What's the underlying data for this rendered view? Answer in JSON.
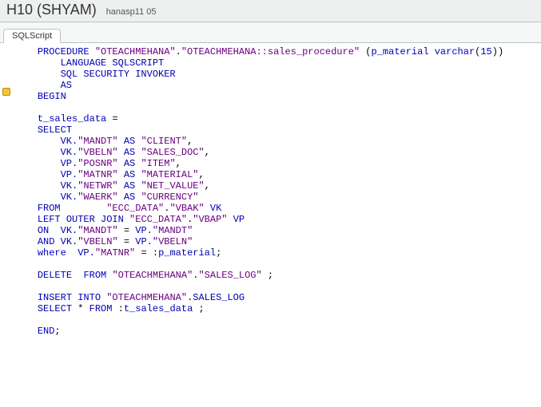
{
  "header": {
    "title": "H10 (SHYAM)",
    "subtitle": "hanasp11 05"
  },
  "tabs": [
    {
      "label": "SQLScript"
    }
  ],
  "code": {
    "tokens": [
      [
        "    ",
        ""
      ],
      [
        "PROCEDURE",
        "kw"
      ],
      [
        " ",
        ""
      ],
      [
        "\"OTEACHMEHANA\"",
        "id"
      ],
      [
        ".",
        ""
      ],
      [
        "\"OTEACHMEHANA::sales_procedure\"",
        "id"
      ],
      [
        " (",
        ""
      ],
      [
        "p_material",
        "kw"
      ],
      [
        " ",
        ""
      ],
      [
        "varchar",
        "kw"
      ],
      [
        "(",
        ""
      ],
      [
        "15",
        "lit"
      ],
      [
        "))",
        ""
      ],
      [
        "\n",
        ""
      ],
      [
        "        ",
        ""
      ],
      [
        "LANGUAGE SQLSCRIPT",
        "kw"
      ],
      [
        "\n",
        ""
      ],
      [
        "        ",
        ""
      ],
      [
        "SQL SECURITY INVOKER",
        "kw"
      ],
      [
        "\n",
        ""
      ],
      [
        "        ",
        ""
      ],
      [
        "AS",
        "kw"
      ],
      [
        "\n",
        ""
      ],
      [
        "    ",
        ""
      ],
      [
        "BEGIN",
        "kw"
      ],
      [
        "\n",
        ""
      ],
      [
        "\n",
        ""
      ],
      [
        "    ",
        ""
      ],
      [
        "t_sales_data",
        "kw"
      ],
      [
        " = ",
        ""
      ],
      [
        "\n",
        ""
      ],
      [
        "    ",
        ""
      ],
      [
        "SELECT",
        "kw"
      ],
      [
        "\n",
        ""
      ],
      [
        "        ",
        ""
      ],
      [
        "VK.",
        "kw"
      ],
      [
        "\"MANDT\"",
        "id"
      ],
      [
        " ",
        ""
      ],
      [
        "AS",
        "kw"
      ],
      [
        " ",
        ""
      ],
      [
        "\"CLIENT\"",
        "id"
      ],
      [
        ", ",
        ""
      ],
      [
        "\n",
        ""
      ],
      [
        "        ",
        ""
      ],
      [
        "VK.",
        "kw"
      ],
      [
        "\"VBELN\"",
        "id"
      ],
      [
        " ",
        ""
      ],
      [
        "AS",
        "kw"
      ],
      [
        " ",
        ""
      ],
      [
        "\"SALES_DOC\"",
        "id"
      ],
      [
        ", ",
        ""
      ],
      [
        "\n",
        ""
      ],
      [
        "        ",
        ""
      ],
      [
        "VP.",
        "kw"
      ],
      [
        "\"POSNR\"",
        "id"
      ],
      [
        " ",
        ""
      ],
      [
        "AS",
        "kw"
      ],
      [
        " ",
        ""
      ],
      [
        "\"ITEM\"",
        "id"
      ],
      [
        ", ",
        ""
      ],
      [
        "\n",
        ""
      ],
      [
        "        ",
        ""
      ],
      [
        "VP.",
        "kw"
      ],
      [
        "\"MATNR\"",
        "id"
      ],
      [
        " ",
        ""
      ],
      [
        "AS",
        "kw"
      ],
      [
        " ",
        ""
      ],
      [
        "\"MATERIAL\"",
        "id"
      ],
      [
        ", ",
        ""
      ],
      [
        "\n",
        ""
      ],
      [
        "        ",
        ""
      ],
      [
        "VK.",
        "kw"
      ],
      [
        "\"NETWR\"",
        "id"
      ],
      [
        " ",
        ""
      ],
      [
        "AS",
        "kw"
      ],
      [
        " ",
        ""
      ],
      [
        "\"NET_VALUE\"",
        "id"
      ],
      [
        ", ",
        ""
      ],
      [
        "\n",
        ""
      ],
      [
        "        ",
        ""
      ],
      [
        "VK.",
        "kw"
      ],
      [
        "\"WAERK\"",
        "id"
      ],
      [
        " ",
        ""
      ],
      [
        "AS",
        "kw"
      ],
      [
        " ",
        ""
      ],
      [
        "\"CURRENCY\"",
        "id"
      ],
      [
        "\n",
        ""
      ],
      [
        "    ",
        ""
      ],
      [
        "FROM",
        "kw"
      ],
      [
        "        ",
        ""
      ],
      [
        "\"ECC_DATA\"",
        "id"
      ],
      [
        ".",
        ""
      ],
      [
        "\"VBAK\"",
        "id"
      ],
      [
        " ",
        ""
      ],
      [
        "VK",
        "kw"
      ],
      [
        "\n",
        ""
      ],
      [
        "    ",
        ""
      ],
      [
        "LEFT OUTER JOIN",
        "kw"
      ],
      [
        " ",
        ""
      ],
      [
        "\"ECC_DATA\"",
        "id"
      ],
      [
        ".",
        ""
      ],
      [
        "\"VBAP\"",
        "id"
      ],
      [
        " ",
        ""
      ],
      [
        "VP",
        "kw"
      ],
      [
        "\n",
        ""
      ],
      [
        "    ",
        ""
      ],
      [
        "ON  VK.",
        "kw"
      ],
      [
        "\"MANDT\"",
        "id"
      ],
      [
        " = ",
        ""
      ],
      [
        "VP.",
        "kw"
      ],
      [
        "\"MANDT\"",
        "id"
      ],
      [
        "\n",
        ""
      ],
      [
        "    ",
        ""
      ],
      [
        "AND VK.",
        "kw"
      ],
      [
        "\"VBELN\"",
        "id"
      ],
      [
        " = ",
        ""
      ],
      [
        "VP.",
        "kw"
      ],
      [
        "\"VBELN\"",
        "id"
      ],
      [
        "\n",
        ""
      ],
      [
        "    ",
        ""
      ],
      [
        "where",
        "kw"
      ],
      [
        "  ",
        ""
      ],
      [
        "VP.",
        "kw"
      ],
      [
        "\"MATNR\"",
        "id"
      ],
      [
        " = :",
        ""
      ],
      [
        "p_material",
        "kw"
      ],
      [
        ";",
        ""
      ],
      [
        "\n",
        ""
      ],
      [
        "\n",
        ""
      ],
      [
        "    ",
        ""
      ],
      [
        "DELETE",
        "kw"
      ],
      [
        "  ",
        ""
      ],
      [
        "FROM",
        "kw"
      ],
      [
        " ",
        ""
      ],
      [
        "\"OTEACHMEHANA\"",
        "id"
      ],
      [
        ".",
        ""
      ],
      [
        "\"SALES_LOG\"",
        "id"
      ],
      [
        " ;",
        ""
      ],
      [
        "\n",
        ""
      ],
      [
        "\n",
        ""
      ],
      [
        "    ",
        ""
      ],
      [
        "INSERT INTO",
        "kw"
      ],
      [
        " ",
        ""
      ],
      [
        "\"OTEACHMEHANA\"",
        "id"
      ],
      [
        ".",
        ""
      ],
      [
        "SALES_LOG",
        "kw"
      ],
      [
        "\n",
        ""
      ],
      [
        "    ",
        ""
      ],
      [
        "SELECT",
        "kw"
      ],
      [
        " * ",
        ""
      ],
      [
        "FROM",
        "kw"
      ],
      [
        " :",
        ""
      ],
      [
        "t_sales_data",
        "kw"
      ],
      [
        " ;",
        ""
      ],
      [
        "\n",
        ""
      ],
      [
        "\n",
        ""
      ],
      [
        "    ",
        ""
      ],
      [
        "END",
        "kw"
      ],
      [
        ";",
        ""
      ],
      [
        "\n",
        ""
      ]
    ]
  }
}
